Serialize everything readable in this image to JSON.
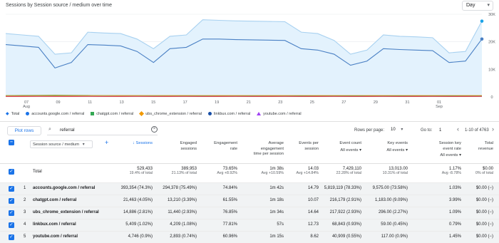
{
  "header": {
    "title": "Sessions by Session source / medium over time",
    "day_select": "Day"
  },
  "chart_data": {
    "type": "area",
    "x_labels": [
      "07\nAug",
      "09",
      "11",
      "13",
      "15",
      "17",
      "19",
      "21",
      "23",
      "25",
      "27",
      "29",
      "31",
      "01\nSep"
    ],
    "y_ticks": [
      "30K",
      "20K",
      "10K",
      "0"
    ],
    "ylim": [
      0,
      30000
    ],
    "series": [
      {
        "name": "Total",
        "color": "#a8d1f0",
        "values": [
          23000,
          22500,
          22000,
          15500,
          16000,
          23500,
          23200,
          23000,
          21000,
          17500,
          22000,
          22500,
          28000,
          27800,
          27600,
          27500,
          27400,
          27300,
          23500,
          23000,
          20500,
          15500,
          17000,
          22500,
          22000,
          21800,
          21500,
          16000,
          16500,
          27500
        ]
      },
      {
        "name": "accounts.google.com / referral",
        "color": "#4a80c4",
        "values": [
          19000,
          18500,
          18000,
          10500,
          12500,
          19000,
          18800,
          18500,
          16500,
          12500,
          17500,
          18000,
          21000,
          21000,
          20800,
          20700,
          20600,
          20500,
          17500,
          17000,
          15500,
          11500,
          13000,
          17500,
          17200,
          17000,
          16800,
          12500,
          13000,
          21000
        ]
      },
      {
        "name": "chatgpt.com / referral",
        "color": "#34a853",
        "values": [
          500,
          550,
          600,
          650,
          600,
          550,
          500,
          480,
          460,
          440,
          430,
          420,
          410,
          400,
          400,
          400,
          400,
          400,
          390,
          380,
          380,
          370,
          370,
          360,
          360,
          350,
          350,
          350,
          350,
          350
        ]
      },
      {
        "name": "ubs_chrome_extension / referral",
        "color": "#f29900",
        "values": [
          450,
          480,
          500,
          520,
          510,
          500,
          500,
          500,
          500,
          500,
          500,
          500,
          500,
          500,
          500,
          500,
          500,
          500,
          500,
          500,
          500,
          500,
          500,
          500,
          500,
          500,
          500,
          500,
          500,
          500
        ]
      },
      {
        "name": "linkbux.com / referral",
        "color": "#174ea6",
        "values": [
          200,
          200,
          200,
          200,
          200,
          200,
          200,
          200,
          200,
          200,
          200,
          200,
          200,
          200,
          200,
          200,
          200,
          200,
          200,
          200,
          200,
          200,
          200,
          200,
          200,
          200,
          200,
          200,
          200,
          200
        ]
      },
      {
        "name": "youtube.com / referral",
        "color": "#e8334a",
        "values": [
          150,
          160,
          170,
          150,
          160,
          170,
          150,
          160,
          170,
          150,
          160,
          170,
          150,
          160,
          170,
          150,
          160,
          170,
          150,
          160,
          170,
          150,
          160,
          170,
          150,
          160,
          170,
          150,
          160,
          170
        ]
      }
    ]
  },
  "legend": [
    {
      "label": "Total",
      "color": "#1a73e8",
      "shape": "marker"
    },
    {
      "label": "accounts.google.com / referral",
      "color": "#1a73e8",
      "shape": "dot"
    },
    {
      "label": "chatgpt.com / referral",
      "color": "#34a853",
      "shape": "square"
    },
    {
      "label": "ubs_chrome_extension / referral",
      "color": "#f29900",
      "shape": "diamond"
    },
    {
      "label": "linkbux.com / referral",
      "color": "#174ea6",
      "shape": "dot"
    },
    {
      "label": "youtube.com / referral",
      "color": "#a142f4",
      "shape": "triangle"
    }
  ],
  "toolbar": {
    "pivot_label": "Plot rows",
    "search_value": "referral",
    "rows_per_page_label": "Rows per page:",
    "rows_per_page_value": "10",
    "goto_label": "Go to:",
    "goto_value": "1",
    "pager_text": "1-10 of 4763"
  },
  "table": {
    "dimension_select": "Session source / medium",
    "headers": [
      {
        "lines": [
          "↓ Sessions"
        ]
      },
      {
        "lines": [
          "Engaged",
          "sessions"
        ]
      },
      {
        "lines": [
          "Engagement",
          "rate"
        ]
      },
      {
        "lines": [
          "Average",
          "engagement",
          "time per session"
        ]
      },
      {
        "lines": [
          "Events per",
          "session"
        ]
      },
      {
        "lines": [
          "Event count"
        ],
        "filter": "All events"
      },
      {
        "lines": [
          "Key events"
        ],
        "filter": "All events"
      },
      {
        "lines": [
          "Session key",
          "event rate"
        ],
        "filter": "All events"
      },
      {
        "lines": [
          "Total",
          "revenue"
        ]
      }
    ],
    "total_label": "Total",
    "totals": [
      {
        "main": "529,433",
        "sub": "19.4% of total"
      },
      {
        "main": "389,953",
        "sub": "21.13% of total"
      },
      {
        "main": "73.65%",
        "sub": "Avg +8.92%"
      },
      {
        "main": "1m 38s",
        "sub": "Avg +10.59%"
      },
      {
        "main": "14.03",
        "sub": "Avg +14.84%"
      },
      {
        "main": "7,429,110",
        "sub": "22.28% of total"
      },
      {
        "main": "13,013.00",
        "sub": "10.31% of total"
      },
      {
        "main": "1.17%",
        "sub": "Avg -8.78%"
      },
      {
        "main": "$0.00",
        "sub": "0% of total"
      }
    ],
    "rows": [
      {
        "n": "1",
        "dim": "accounts.google.com / referral",
        "cells": [
          "393,354 (74.3%)",
          "294,378 (75.49%)",
          "74.84%",
          "1m 42s",
          "14.79",
          "5,819,119 (78.33%)",
          "9,575.00 (73.58%)",
          "1.03%",
          "$0.00 (−)"
        ]
      },
      {
        "n": "2",
        "dim": "chatgpt.com / referral",
        "cells": [
          "21,463 (4.05%)",
          "13,210 (3.39%)",
          "61.55%",
          "1m 18s",
          "10.07",
          "216,179 (2.91%)",
          "1,183.00 (9.09%)",
          "3.99%",
          "$0.00 (−)"
        ]
      },
      {
        "n": "3",
        "dim": "ubs_chrome_extension / referral",
        "cells": [
          "14,886 (2.81%)",
          "11,440 (2.93%)",
          "76.85%",
          "1m 34s",
          "14.64",
          "217,922 (2.93%)",
          "296.00 (2.27%)",
          "1.09%",
          "$0.00 (−)"
        ]
      },
      {
        "n": "4",
        "dim": "linkbux.com / referral",
        "cells": [
          "5,409 (1.02%)",
          "4,209 (1.08%)",
          "77.81%",
          "57s",
          "12.73",
          "68,843 (0.93%)",
          "59.00 (0.45%)",
          "0.79%",
          "$0.00 (−)"
        ]
      },
      {
        "n": "5",
        "dim": "youtube.com / referral",
        "cells": [
          "4,746 (0.9%)",
          "2,893 (0.74%)",
          "60.96%",
          "1m 15s",
          "8.62",
          "40,909 (0.55%)",
          "117.00 (0.9%)",
          "1.45%",
          "$0.00 (−)"
        ]
      }
    ]
  }
}
